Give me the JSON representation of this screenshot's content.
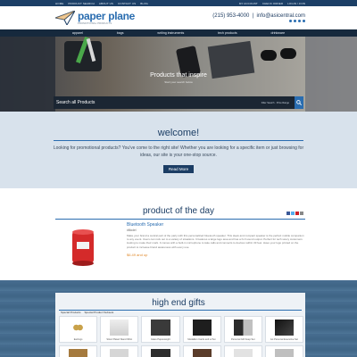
{
  "topbar": {
    "links": [
      "HOME",
      "PRODUCT SEARCH",
      "ABOUT US",
      "CONTACT US",
      "BLOG"
    ],
    "right": [
      "MY ACCOUNT",
      "CHECK ORDER",
      "LOGIN / JOIN"
    ]
  },
  "header": {
    "logo_name": "paper plane",
    "logo_tagline": "PROMOTIONAL PRODUCTS",
    "phone": "(215) 953-4000",
    "email": "info@asicentral.com"
  },
  "nav": [
    "apparel",
    "bags",
    "writing instruments",
    "tech products",
    "drinkware"
  ],
  "hero": {
    "title": "Products that inspire",
    "subtitle": "Start your search below",
    "search_label": "Search all Products",
    "filter": "Filter Search · Price Range"
  },
  "welcome": {
    "title": "welcome!",
    "text": "Looking for promotional products? You've come to the right site! Whether you are looking for a specific item or just browsing for ideas, our site is your one-stop source.",
    "button": "Read More"
  },
  "potd": {
    "title": "product of the day",
    "name": "Bluetooth Speaker",
    "sku": "#Model",
    "desc": "Make your brand a central part of the party with this personalized bluetooth speaker. This sleek and compact speaker is the perfect mobile companion to any event. Users can rock out to a variety of situations. It features a large logo area and has a hi-fi sound output. Perfect for tech savvy customers looking to make their mark. It comes with a built-in microphone to take calls and connects to devices within 33 feet. Have your logo printed on the product to increase brand awareness with every use.",
    "price": "$6.49 and up"
  },
  "gifts": {
    "title": "high end gifts",
    "tabs": [
      "Special Products",
      "Special Product Subsets"
    ],
    "items": [
      "Earrings",
      "Silver Plated Stand Wrist",
      "Glass Paperweight",
      "Medallion Cards and a Pen",
      "Personal Gift Keep Set",
      "Jet Personal Executive Set",
      "",
      "",
      "",
      "",
      "",
      ""
    ]
  }
}
